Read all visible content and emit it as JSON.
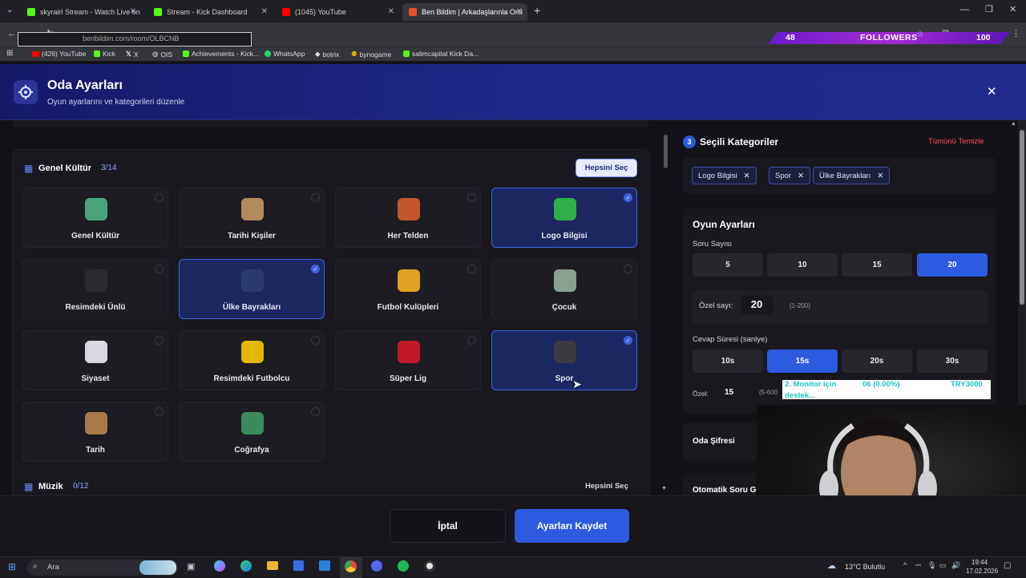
{
  "browser": {
    "tabs": [
      {
        "title": "skyrairl Stream - Watch Live on",
        "color": "#53fc18"
      },
      {
        "title": "Stream - Kick Dashboard",
        "color": "#53fc18"
      },
      {
        "title": "(1045) YouTube",
        "color": "#ff0000"
      },
      {
        "title": "Ben Bildim | Arkadaşlarınla Onli",
        "color": "#e8502a"
      }
    ],
    "url": "benbildim.com/room/OLBCNB",
    "bookmarks": [
      "(426) YouTube",
      "Kick",
      "X",
      "OIS",
      "Achievements - Kick...",
      "WhatsApp",
      "botrix",
      "bynogame",
      "salimcapital Kick Da..."
    ]
  },
  "overlay": {
    "followers_count": "48",
    "followers_label": "FOLLOWERS",
    "followers_goal": "100",
    "donation_left": "2. Monitor için",
    "donation_mid": "06 (0.00%)",
    "donation_right": "TRY3000",
    "donation_sub": "destek..."
  },
  "header": {
    "title": "Oda Ayarları",
    "subtitle": "Oyun ayarlarını ve kategorileri düzenle"
  },
  "left": {
    "section1": {
      "title": "Genel Kültür",
      "count": "3/14",
      "select_all": "Hepsini Seç"
    },
    "cards": [
      {
        "label": "Genel Kültür",
        "selected": false,
        "icon": "brain-icon",
        "color": "#4aa37a"
      },
      {
        "label": "Tarihi Kişiler",
        "selected": false,
        "icon": "historic-person-icon",
        "color": "#b58a5a"
      },
      {
        "label": "Her Telden",
        "selected": false,
        "icon": "mixed-icon",
        "color": "#c2572a"
      },
      {
        "label": "Logo Bilgisi",
        "selected": true,
        "icon": "logo-icon",
        "color": "#2fae4a"
      },
      {
        "label": "Resimdeki Ünlü",
        "selected": false,
        "icon": "celebrity-icon",
        "color": "#2a2a30"
      },
      {
        "label": "Ülke Bayrakları",
        "selected": true,
        "icon": "flag-globe-icon",
        "color": "#2b3a6e"
      },
      {
        "label": "Futbol Kulüpleri",
        "selected": false,
        "icon": "wolf-crest-icon",
        "color": "#e0a020"
      },
      {
        "label": "Çocuk",
        "selected": false,
        "icon": "child-icon",
        "color": "#8aa090"
      },
      {
        "label": "Siyaset",
        "selected": false,
        "icon": "parliament-icon",
        "color": "#d8d8e0"
      },
      {
        "label": "Resimdeki Futbolcu",
        "selected": false,
        "icon": "footballer-icon",
        "color": "#e4b800"
      },
      {
        "label": "Süper Lig",
        "selected": false,
        "icon": "club-badge-icon",
        "color": "#c01a2a"
      },
      {
        "label": "Spor",
        "selected": true,
        "icon": "ball-icon",
        "color": "#3a3a40"
      },
      {
        "label": "Tarih",
        "selected": false,
        "icon": "colosseum-icon",
        "color": "#a87a4a"
      },
      {
        "label": "Coğrafya",
        "selected": false,
        "icon": "landscape-icon",
        "color": "#3a8a5a"
      }
    ],
    "section2": {
      "title": "Müzik",
      "count": "0/12",
      "select_all": "Hepsini Seç"
    }
  },
  "right": {
    "step": "3",
    "title": "Seçili Kategoriler",
    "clear": "Tümünü Temizle",
    "chips": [
      "Logo Bilgisi",
      "Spor",
      "Ülke Bayrakları"
    ],
    "game_title": "Oyun Ayarları",
    "q_label": "Soru Sayısı",
    "q_options": [
      "5",
      "10",
      "15",
      "20"
    ],
    "q_selected": "20",
    "custom_label": "Özel sayı:",
    "custom_value": "20",
    "custom_range": "(1-200)",
    "time_label": "Cevap Süresi (saniye)",
    "time_options": [
      "10s",
      "15s",
      "20s",
      "30s"
    ],
    "time_selected": "15s",
    "time_custom_label": "Özel:",
    "time_custom_value": "15",
    "time_custom_range": "(5-600",
    "password_label": "Oda Şifresi",
    "auto_label": "Otomatik Soru Ge"
  },
  "footer": {
    "cancel": "İptal",
    "save": "Ayarları Kaydet"
  },
  "taskbar": {
    "search": "Ara",
    "weather": "13°C  Bulutlu",
    "time": "19:44",
    "date": "17.02.2026"
  }
}
